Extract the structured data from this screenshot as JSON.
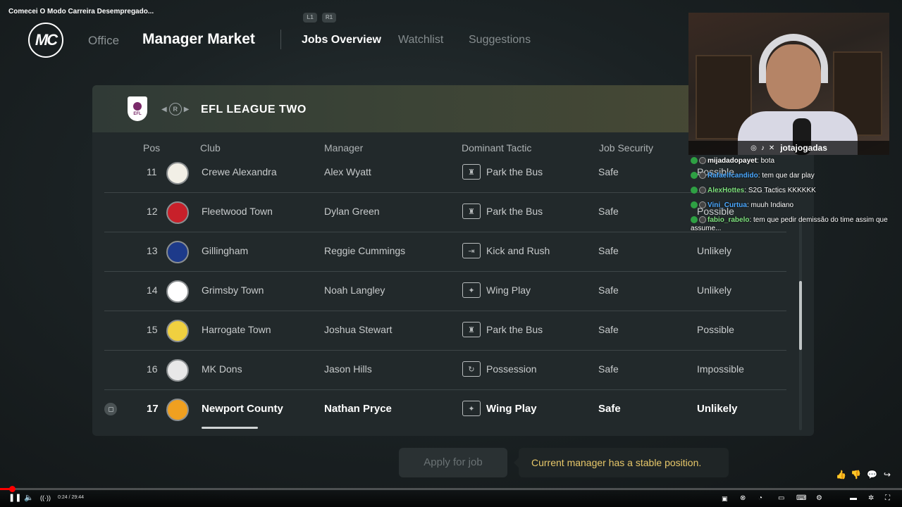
{
  "video": {
    "title": "Comecei O Modo Carreira Desempregado...",
    "time": "0:24 / 29:44",
    "progress": 0.0134
  },
  "header": {
    "logo": "MC",
    "shoulder_left": "L1",
    "shoulder_right": "R1",
    "office": "Office",
    "title": "Manager Market",
    "tabs": [
      {
        "label": "Jobs Overview",
        "active": true
      },
      {
        "label": "Watchlist",
        "active": false
      },
      {
        "label": "Suggestions",
        "active": false
      }
    ]
  },
  "league": {
    "badge_text": "EFL",
    "switch_button": "R",
    "name": "EFL LEAGUE TWO"
  },
  "table": {
    "columns": [
      "Pos",
      "Club",
      "Manager",
      "Dominant Tactic",
      "Job Security"
    ],
    "rows": [
      {
        "pos": "11",
        "club": "Crewe Alexandra",
        "manager": "Alex Wyatt",
        "tactic": "Park the Bus",
        "tactic_icon": "bus-icon",
        "security": "Safe",
        "chance": "Possible",
        "crest_color": "#f2efe6"
      },
      {
        "pos": "12",
        "club": "Fleetwood Town",
        "manager": "Dylan Green",
        "tactic": "Park the Bus",
        "tactic_icon": "bus-icon",
        "security": "Safe",
        "chance": "Possible",
        "crest_color": "#c8202a"
      },
      {
        "pos": "13",
        "club": "Gillingham",
        "manager": "Reggie Cummings",
        "tactic": "Kick and Rush",
        "tactic_icon": "arrow-icon",
        "security": "Safe",
        "chance": "Unlikely",
        "crest_color": "#1d3a8a"
      },
      {
        "pos": "14",
        "club": "Grimsby Town",
        "manager": "Noah Langley",
        "tactic": "Wing Play",
        "tactic_icon": "wings-icon",
        "security": "Safe",
        "chance": "Unlikely",
        "crest_color": "#ffffff"
      },
      {
        "pos": "15",
        "club": "Harrogate Town",
        "manager": "Joshua Stewart",
        "tactic": "Park the Bus",
        "tactic_icon": "bus-icon",
        "security": "Safe",
        "chance": "Possible",
        "crest_color": "#f0d040"
      },
      {
        "pos": "16",
        "club": "MK Dons",
        "manager": "Jason Hills",
        "tactic": "Possession",
        "tactic_icon": "possession-icon",
        "security": "Safe",
        "chance": "Impossible",
        "crest_color": "#e8e8e8"
      },
      {
        "pos": "17",
        "club": "Newport County",
        "manager": "Nathan Pryce",
        "tactic": "Wing Play",
        "tactic_icon": "wings-icon",
        "security": "Safe",
        "chance": "Unlikely",
        "crest_color": "#f0a020",
        "selected": true
      }
    ]
  },
  "footer": {
    "apply_button": "Apply for job",
    "tooltip": "Current manager has a stable position."
  },
  "stream": {
    "handle": "jotajogadas",
    "social_icons": [
      "instagram-icon",
      "tiktok-icon",
      "x-icon"
    ],
    "chat": [
      {
        "user": "mijadadopayet",
        "color": "#ffffff",
        "text": "bota"
      },
      {
        "user": "Rafaelfcandido",
        "color": "#4aa8ff",
        "text": "tem que dar play"
      },
      {
        "user": "AlexHottes",
        "color": "#7ee27e",
        "text": "S2G Tactics KKKKKK"
      },
      {
        "user": "Vini_Curtua",
        "color": "#4aa8ff",
        "text": "muuh Indiano"
      },
      {
        "user": "fabio_rabelo",
        "color": "#7ee27e",
        "text": "tem que pedir demissão do time assim que assume..."
      }
    ]
  },
  "colors": {
    "tooltip_text": "#e8c86a",
    "progress": "#ff0000"
  }
}
